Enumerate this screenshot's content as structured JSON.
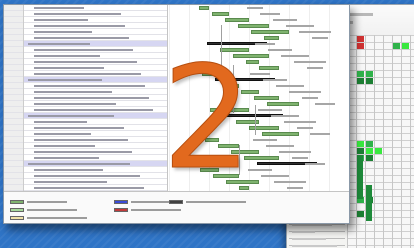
{
  "step": {
    "number": "2"
  },
  "colors": {
    "desktop_background": "#2f74c6",
    "numeral": "#e2691e",
    "summary_row": "#d6d6f2",
    "task_bar": "#7fb36f",
    "grid_highlight": "#2fb24a"
  },
  "legend": {
    "items": [
      {
        "swatch_color": "#7fb36f",
        "icon": "green-bar-swatch"
      },
      {
        "swatch_color": "#a8d99c",
        "icon": "light-green-swatch"
      },
      {
        "swatch_color": "#f0e2a8",
        "icon": "tan-swatch"
      },
      {
        "swatch_color": "#3a4bd6",
        "icon": "blue-swatch"
      },
      {
        "swatch_color": "#c03a3a",
        "icon": "red-swatch"
      },
      {
        "swatch_color": "#404040",
        "icon": "black-summary-swatch"
      }
    ]
  }
}
